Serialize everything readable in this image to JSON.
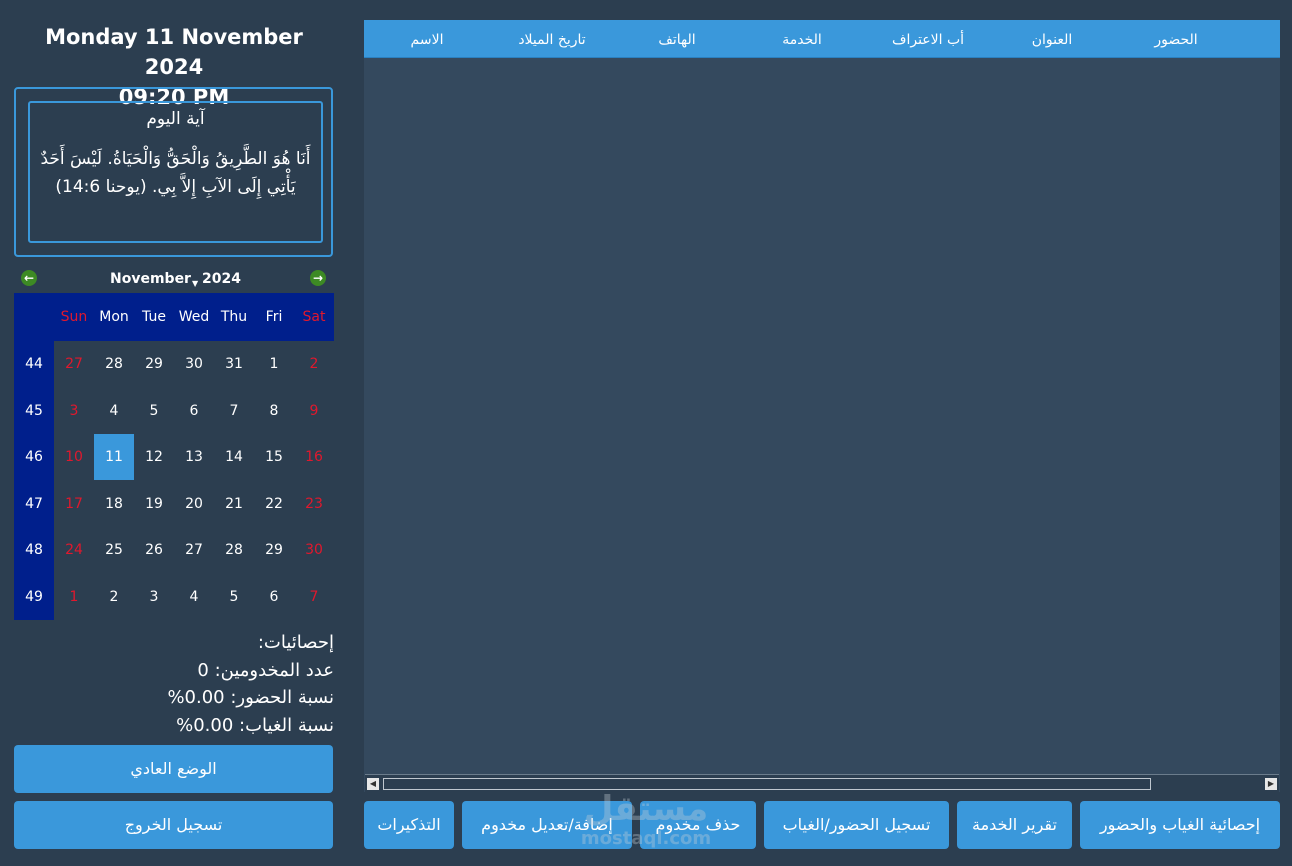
{
  "header": {
    "date": "Monday 11 November 2024",
    "time": "09:20 PM"
  },
  "verse": {
    "title": "آية اليوم",
    "text": "أَنَا هُوَ الطَّرِيقُ وَالْحَقُّ وَالْحَيَاةُ. لَيْسَ أَحَدٌ يَأْتِي إِلَى الآبِ إِلاَّ بِي.   (يوحنا 14:6)"
  },
  "calendar": {
    "month": "November",
    "year": "2024",
    "weekdays": [
      "Sun",
      "Mon",
      "Tue",
      "Wed",
      "Thu",
      "Fri",
      "Sat"
    ],
    "weeks": [
      {
        "num": "44",
        "days": [
          "27",
          "28",
          "29",
          "30",
          "31",
          "1",
          "2"
        ]
      },
      {
        "num": "45",
        "days": [
          "3",
          "4",
          "5",
          "6",
          "7",
          "8",
          "9"
        ]
      },
      {
        "num": "46",
        "days": [
          "10",
          "11",
          "12",
          "13",
          "14",
          "15",
          "16"
        ]
      },
      {
        "num": "47",
        "days": [
          "17",
          "18",
          "19",
          "20",
          "21",
          "22",
          "23"
        ]
      },
      {
        "num": "48",
        "days": [
          "24",
          "25",
          "26",
          "27",
          "28",
          "29",
          "30"
        ]
      },
      {
        "num": "49",
        "days": [
          "1",
          "2",
          "3",
          "4",
          "5",
          "6",
          "7"
        ]
      }
    ],
    "selected_day": "11",
    "weekend_color": "#e0182d",
    "header_color": "#001f8c",
    "selected_color": "#3a98db"
  },
  "stats": {
    "title": "إحصائيات:",
    "count_line": "عدد المخدومين: 0",
    "attendance_line": "نسبة الحضور: 0.00%",
    "absence_line": "نسبة الغياب: 0.00%"
  },
  "sidebar_buttons": {
    "normal_mode": "الوضع العادي",
    "logout": "تسجيل الخروج"
  },
  "table": {
    "columns": [
      "الحضور",
      "العنوان",
      "أب الاعتراف",
      "الخدمة",
      "الهاتف",
      "تاريخ الميلاد",
      "الاسم"
    ],
    "rows": []
  },
  "bottom_buttons": {
    "attendance_stats": "إحصائية الغياب والحضور",
    "service_report": "تقرير الخدمة",
    "record_attendance": "تسجيل الحضور/الغياب",
    "delete_member": "حذف مخدوم",
    "add_edit_member": "إضافة/تعديل مخدوم",
    "tickets": "التذكيرات"
  },
  "watermark": {
    "text_ar": "مستقل",
    "text_en": "mostaql.com"
  },
  "colors": {
    "background": "#2c3e50",
    "panel": "#34495e",
    "accent": "#3a98db"
  }
}
